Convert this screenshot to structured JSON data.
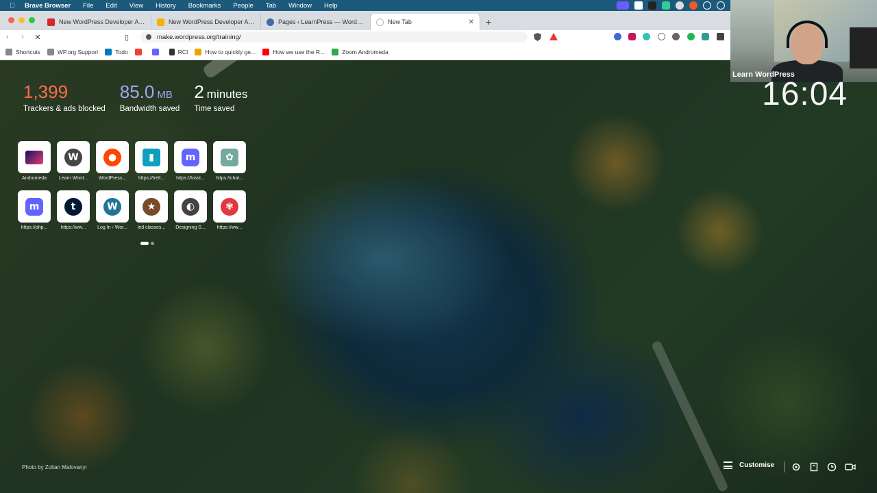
{
  "menubar": {
    "app": "Brave Browser",
    "items": [
      "File",
      "Edit",
      "View",
      "History",
      "Bookmarks",
      "People",
      "Tab",
      "Window",
      "Help"
    ]
  },
  "tabs": [
    {
      "title": "New WordPress Developer APIs: Tr",
      "icon": "wordpress-red-icon"
    },
    {
      "title": "New WordPress Developer APIs Th",
      "icon": "slides-icon"
    },
    {
      "title": "Pages ‹ LearnPress — WordPress",
      "icon": "wordpress-icon"
    },
    {
      "title": "New Tab",
      "icon": "loading-icon"
    }
  ],
  "address": {
    "url": "make.wordpress.org/training/"
  },
  "bookmarks": [
    {
      "label": "Shortcuts",
      "icon": "folder-icon"
    },
    {
      "label": "WP.org Support",
      "icon": "folder-icon"
    },
    {
      "label": "Todo",
      "icon": "trello-icon"
    },
    {
      "label": "",
      "icon": "gmail-icon"
    },
    {
      "label": "",
      "icon": "mastodon-icon"
    },
    {
      "label": "RCI",
      "icon": "rci-icon"
    },
    {
      "label": "How to quickly ge...",
      "icon": "grid-icon"
    },
    {
      "label": "How we use the R...",
      "icon": "youtube-icon"
    },
    {
      "label": "Zoom Andromeda",
      "icon": "zoom-icon"
    }
  ],
  "stats": {
    "trackers": {
      "value": "1,399",
      "label": "Trackers & ads blocked",
      "color": "#ff6b52"
    },
    "bandwidth": {
      "value": "85.0",
      "unit": "MB",
      "label": "Bandwidth saved",
      "color": "#a9a3f5"
    },
    "time": {
      "value": "2",
      "unit": "minutes",
      "label": "Time saved",
      "color": "#ffffff"
    }
  },
  "top_sites": [
    {
      "caption": "Andromeda",
      "icon": "galaxy-icon"
    },
    {
      "caption": "Learn Word...",
      "icon": "wordpress-icon"
    },
    {
      "caption": "WordPress...",
      "icon": "reddit-icon"
    },
    {
      "caption": "https://trell...",
      "icon": "trello-icon"
    },
    {
      "caption": "https://fosst...",
      "icon": "mastodon-icon"
    },
    {
      "caption": "https://chat...",
      "icon": "openai-icon"
    },
    {
      "caption": "https://php...",
      "icon": "mastodon-icon"
    },
    {
      "caption": "https://ww...",
      "icon": "tumblr-icon"
    },
    {
      "caption": "Log In ‹ Wor...",
      "icon": "wordpress-icon"
    },
    {
      "caption": "led classes...",
      "icon": "badge-icon"
    },
    {
      "caption": "Designing S...",
      "icon": "globe-icon"
    },
    {
      "caption": "https://ww...",
      "icon": "flower-icon"
    }
  ],
  "webcam": {
    "label": "Learn WordPress"
  },
  "clock": "16:04",
  "footer": {
    "credit": "Photo by Zoltan Malovanyi",
    "customise": "Customise"
  }
}
